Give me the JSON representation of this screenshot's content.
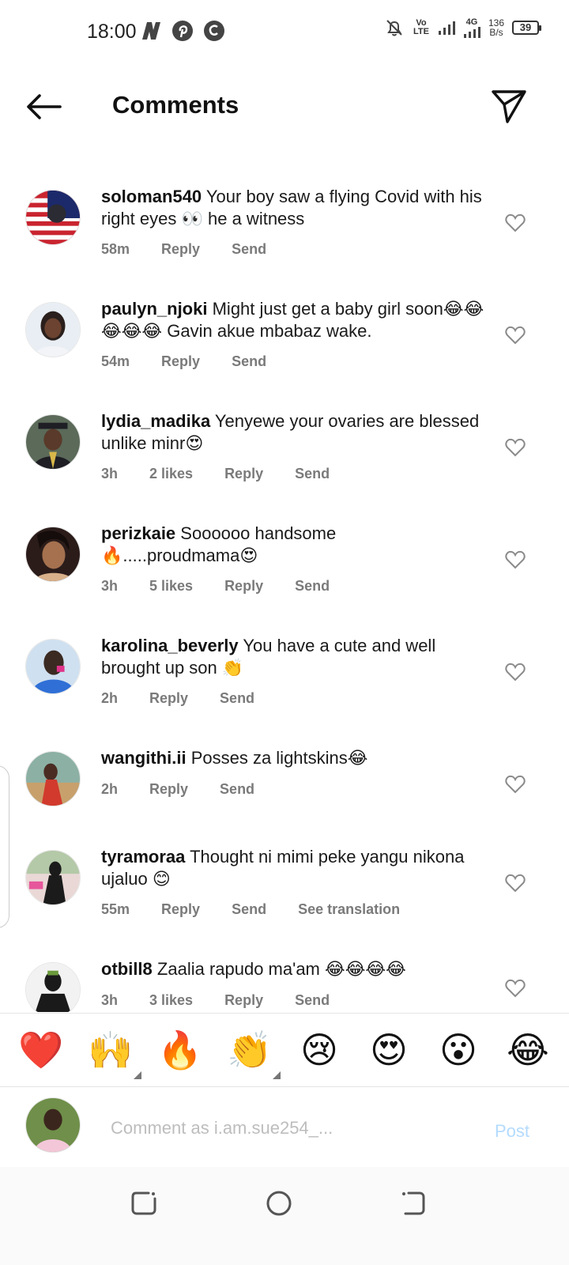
{
  "status_bar": {
    "time": "18:00",
    "network": "Vo LTE",
    "signal_label": "4G",
    "speed_value": "136",
    "speed_unit": "B/s",
    "battery": "39"
  },
  "header": {
    "title": "Comments"
  },
  "comments": [
    {
      "username": "soloman540",
      "text": "Your boy saw a flying Covid with his right eyes 👀 he a witness",
      "time": "58m",
      "likes": "",
      "reply": "Reply",
      "send": "Send",
      "translate": "",
      "avatar_colors": [
        "#1c2a6b",
        "#c9242f"
      ]
    },
    {
      "username": "paulyn_njoki",
      "text": "Might just get a baby girl soon😂😂😂😂😂 Gavin akue mbabaz wake.",
      "time": "54m",
      "likes": "",
      "reply": "Reply",
      "send": "Send",
      "translate": "",
      "avatar_colors": [
        "#e8eef4",
        "#2a1f1c"
      ]
    },
    {
      "username": "lydia_madika",
      "text": "Yenyewe your ovaries are blessed unlike minr😍",
      "time": "3h",
      "likes": "2 likes",
      "reply": "Reply",
      "send": "Send",
      "translate": "",
      "avatar_colors": [
        "#5b6a59",
        "#1e1e24"
      ]
    },
    {
      "username": "perizkaie",
      "text": "Soooooo handsome 🔥.....proudmama😍",
      "time": "3h",
      "likes": "5 likes",
      "reply": "Reply",
      "send": "Send",
      "translate": "",
      "avatar_colors": [
        "#2b1c1a",
        "#d8b089"
      ]
    },
    {
      "username": "karolina_beverly",
      "text": "You have a cute and well brought up son 👏",
      "time": "2h",
      "likes": "",
      "reply": "Reply",
      "send": "Send",
      "translate": "",
      "avatar_colors": [
        "#2f6fd6",
        "#3a2a22"
      ]
    },
    {
      "username": "wangithi.ii",
      "text": "Posses za lightskins😂",
      "time": "2h",
      "likes": "",
      "reply": "Reply",
      "send": "Send",
      "translate": "",
      "avatar_colors": [
        "#8cb0a4",
        "#d13a2d"
      ]
    },
    {
      "username": "tyramoraa",
      "text": "Thought ni mimi peke yangu nikona ujaluo 😊",
      "time": "55m",
      "likes": "",
      "reply": "Reply",
      "send": "Send",
      "translate": "See translation",
      "avatar_colors": [
        "#e9d8d6",
        "#1b1b1b"
      ]
    },
    {
      "username": "otbill8",
      "text": "Zaalia rapudo ma'am 😂😂😂😂",
      "time": "3h",
      "likes": "3 likes",
      "reply": "Reply",
      "send": "Send",
      "translate": "",
      "avatar_colors": [
        "#f2f2f2",
        "#1a1a1a"
      ]
    }
  ],
  "reactions": [
    {
      "emoji": "❤️",
      "has_variants": false
    },
    {
      "emoji": "🙌",
      "has_variants": true
    },
    {
      "emoji": "🔥",
      "has_variants": false
    },
    {
      "emoji": "👏",
      "has_variants": true
    },
    {
      "emoji": "😢",
      "has_variants": false
    },
    {
      "emoji": "😍",
      "has_variants": false
    },
    {
      "emoji": "😮",
      "has_variants": false
    },
    {
      "emoji": "😂",
      "has_variants": false
    }
  ],
  "composer": {
    "placeholder": "Comment as i.am.sue254_...",
    "post_label": "Post"
  },
  "icons": {
    "back": "arrow-left-icon",
    "direct": "paper-plane-icon",
    "like": "heart-outline-icon",
    "mute": "bell-off-icon"
  },
  "colors": {
    "post_button_disabled": "#b3dbff",
    "meta_text": "#7a7a7a"
  }
}
